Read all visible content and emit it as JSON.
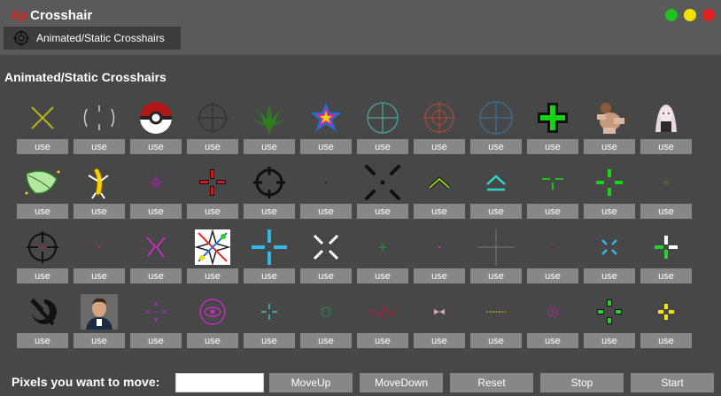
{
  "window": {
    "title_prefix": "Xp",
    "title_name": "Crosshair",
    "buttons": [
      {
        "name": "minimize",
        "color": "#1ec21e"
      },
      {
        "name": "maximize",
        "color": "#f0e000"
      },
      {
        "name": "close",
        "color": "#e0201e"
      }
    ]
  },
  "tab": {
    "label": "Animated/Static Crosshairs",
    "icon": "crosshair-icon"
  },
  "section": {
    "heading": "Animated/Static Crosshairs"
  },
  "crosshairs": [
    {
      "icon": "yellow-x-crosshair-icon",
      "use_label": "use"
    },
    {
      "icon": "gray-bracket-crosshair-icon",
      "use_label": "use"
    },
    {
      "icon": "pokeball-crosshair-icon",
      "use_label": "use"
    },
    {
      "icon": "dark-scope-crosshair-icon",
      "use_label": "use"
    },
    {
      "icon": "leaf-crosshair-icon",
      "use_label": "use"
    },
    {
      "icon": "rainbow-star-crosshair-icon",
      "use_label": "use"
    },
    {
      "icon": "teal-scope-crosshair-icon",
      "use_label": "use"
    },
    {
      "icon": "red-scope-crosshair-icon",
      "use_label": "use"
    },
    {
      "icon": "blue-scope-crosshair-icon",
      "use_label": "use"
    },
    {
      "icon": "green-plus-crosshair-icon",
      "use_label": "use"
    },
    {
      "icon": "dancing-man-crosshair-icon",
      "use_label": "use"
    },
    {
      "icon": "anime-girl-crosshair-icon",
      "use_label": "use"
    },
    {
      "icon": "green-leaf-crosshair-icon",
      "use_label": "use"
    },
    {
      "icon": "dancing-banana-crosshair-icon",
      "use_label": "use"
    },
    {
      "icon": "small-purple-crosshair-icon",
      "use_label": "use"
    },
    {
      "icon": "red-cross-crosshair-icon",
      "use_label": "use"
    },
    {
      "icon": "black-circle-crosshair-icon",
      "use_label": "use"
    },
    {
      "icon": "dot-crosshair-icon",
      "use_label": "use"
    },
    {
      "icon": "black-x-dots-crosshair-icon",
      "use_label": "use"
    },
    {
      "icon": "green-chevron-crosshair-icon",
      "use_label": "use"
    },
    {
      "icon": "teal-chevron-crosshair-icon",
      "use_label": "use"
    },
    {
      "icon": "green-t-crosshair-icon",
      "use_label": "use"
    },
    {
      "icon": "green-dashed-crosshair-icon",
      "use_label": "use"
    },
    {
      "icon": "tiny-green-crosshair-icon",
      "use_label": "use"
    },
    {
      "icon": "black-scope-crosshair-icon",
      "use_label": "use"
    },
    {
      "icon": "red-dot-crosshair-icon",
      "use_label": "use"
    },
    {
      "icon": "pink-x-crosshair-icon",
      "use_label": "use"
    },
    {
      "icon": "rainbow-burst-crosshair-icon",
      "use_label": "use"
    },
    {
      "icon": "blue-cross-crosshair-icon",
      "use_label": "use"
    },
    {
      "icon": "white-x-crosshair-icon",
      "use_label": "use"
    },
    {
      "icon": "tiny-green-plus-crosshair-icon",
      "use_label": "use"
    },
    {
      "icon": "pink-dot-crosshair-icon",
      "use_label": "use"
    },
    {
      "icon": "gray-thin-cross-crosshair-icon",
      "use_label": "use"
    },
    {
      "icon": "dark-red-dot-crosshair-icon",
      "use_label": "use"
    },
    {
      "icon": "blue-x-crosshair-icon",
      "use_label": "use"
    },
    {
      "icon": "green-white-cross-crosshair-icon",
      "use_label": "use"
    },
    {
      "icon": "hammer-sickle-crosshair-icon",
      "use_label": "use"
    },
    {
      "icon": "man-portrait-crosshair-icon",
      "use_label": "use"
    },
    {
      "icon": "purple-arrows-crosshair-icon",
      "use_label": "use"
    },
    {
      "icon": "pink-eye-crosshair-icon",
      "use_label": "use"
    },
    {
      "icon": "teal-small-cross-crosshair-icon",
      "use_label": "use"
    },
    {
      "icon": "green-smile-crosshair-icon",
      "use_label": "use"
    },
    {
      "icon": "red-scribble-crosshair-icon",
      "use_label": "use"
    },
    {
      "icon": "pink-bow-crosshair-icon",
      "use_label": "use"
    },
    {
      "icon": "yellow-dotted-crosshair-icon",
      "use_label": "use"
    },
    {
      "icon": "purple-circle-crosshair-icon",
      "use_label": "use"
    },
    {
      "icon": "green-cross-dots-crosshair-icon",
      "use_label": "use"
    },
    {
      "icon": "yellow-plus-crosshair-icon",
      "use_label": "use"
    }
  ],
  "footer": {
    "label": "Pixels you want to move:",
    "input_value": "",
    "buttons": {
      "move_up": "MoveUp",
      "move_down": "MoveDown",
      "reset": "Reset",
      "stop": "Stop",
      "start": "Start"
    }
  }
}
